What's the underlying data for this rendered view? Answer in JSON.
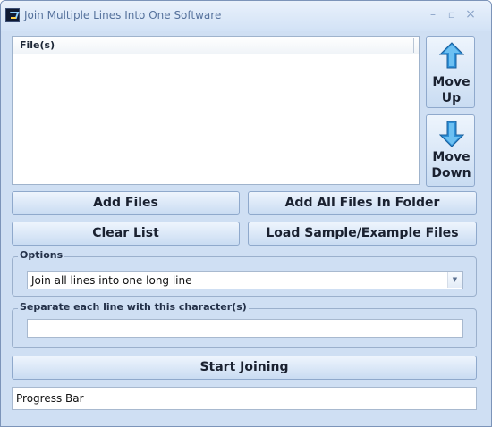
{
  "window": {
    "title": "Join Multiple Lines Into One Software",
    "icon": "app-logo-icon",
    "controls": {
      "minimize": "–",
      "maximize": "▫",
      "close": "×"
    }
  },
  "files": {
    "column_header": "File(s)",
    "rows": []
  },
  "buttons": {
    "move_up": [
      "Move",
      "Up"
    ],
    "move_down": [
      "Move",
      "Down"
    ],
    "add_files": "Add Files",
    "add_all_files_in_folder": "Add All Files In Folder",
    "clear_list": "Clear List",
    "load_sample": "Load Sample/Example Files",
    "start_joining": "Start Joining"
  },
  "options": {
    "legend": "Options",
    "selected": "Join all lines into one long line"
  },
  "separator": {
    "legend": "Separate each line with this character(s)",
    "value": ""
  },
  "progress": {
    "label": "Progress Bar",
    "percent": 0
  },
  "colors": {
    "accent_arrow": "#2d8fd6",
    "background": "#cfdff3"
  }
}
